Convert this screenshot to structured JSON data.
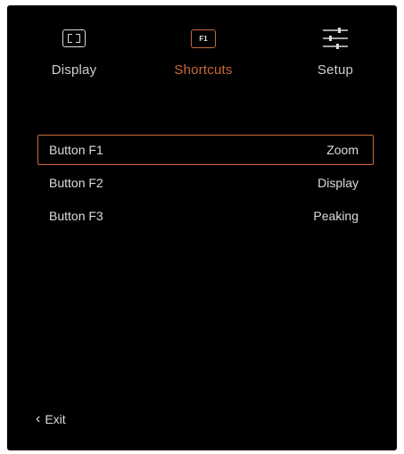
{
  "tabs": [
    {
      "label": "Display",
      "icon": "display-icon",
      "active": false
    },
    {
      "label": "Shortcuts",
      "icon": "f1-icon",
      "icon_text": "F1",
      "active": true
    },
    {
      "label": "Setup",
      "icon": "sliders-icon",
      "active": false
    }
  ],
  "shortcuts": [
    {
      "button": "Button F1",
      "value": "Zoom",
      "selected": true
    },
    {
      "button": "Button F2",
      "value": "Display",
      "selected": false
    },
    {
      "button": "Button F3",
      "value": "Peaking",
      "selected": false
    }
  ],
  "exit_label": "Exit",
  "colors": {
    "background": "#000000",
    "accent": "#c8693a",
    "text": "#dcdcdc"
  }
}
